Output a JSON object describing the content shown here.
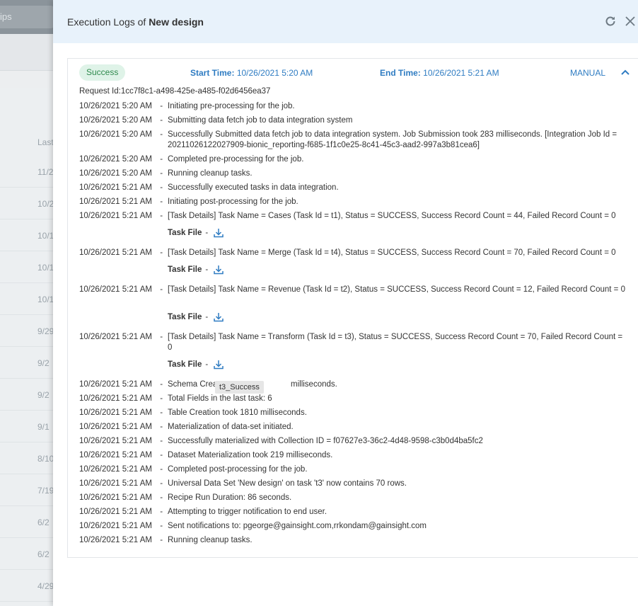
{
  "background": {
    "search_text": "ips",
    "column_header": "Last",
    "rows": [
      "11/2",
      "10/2",
      "10/1",
      "10/1",
      "10/1",
      "9/29",
      "9/2",
      "9/2",
      "9/1",
      "8/10",
      "7/19",
      "6/2",
      "6/2",
      "4/29"
    ]
  },
  "drawer": {
    "title_prefix": "Execution Logs of",
    "title_name": "New design",
    "refresh_icon": "refresh-icon",
    "close_icon": "close-icon"
  },
  "log": {
    "status": "Success",
    "start_time_label": "Start Time:",
    "start_time": "10/26/2021 5:20 AM",
    "end_time_label": "End Time:",
    "end_time": "10/26/2021 5:21 AM",
    "mode": "MANUAL",
    "request_id": "Request Id:1cc7f8c1-a498-425e-a485-f02d6456ea37",
    "task_file_label": "Task File",
    "task_file_dash": "-",
    "entries": [
      {
        "time": "10/26/2021 5:20 AM",
        "sep": " - ",
        "msg": "Initiating pre-processing for the job."
      },
      {
        "time": "10/26/2021 5:20 AM",
        "sep": " - ",
        "msg": "Submitting data fetch job to data integration system"
      },
      {
        "time": "10/26/2021 5:20 AM",
        "sep": " - ",
        "msg": "Successfully Submitted data fetch job to data integration system. Job Submission took 283 milliseconds. [Integration Job Id = 20211026122027909-bionic_reporting-f685-1f1c0e25-8c41-45c3-aad2-997a3b81cea6]"
      },
      {
        "time": "10/26/2021 5:20 AM",
        "sep": " - ",
        "msg": "Completed pre-processing for the job."
      },
      {
        "time": "10/26/2021 5:20 AM",
        "sep": " - ",
        "msg": "Running cleanup tasks."
      },
      {
        "time": "10/26/2021 5:21 AM",
        "sep": " - ",
        "msg": "Successfully executed tasks in data integration."
      },
      {
        "time": "10/26/2021 5:21 AM",
        "sep": " - ",
        "msg": "Initiating post-processing for the job."
      },
      {
        "time": "10/26/2021 5:21 AM",
        "sep": " - ",
        "msg": "[Task Details] Task Name = Cases (Task Id = t1), Status = SUCCESS, Success Record Count = 44, Failed Record Count = 0"
      },
      {
        "time": "10/26/2021 5:21 AM",
        "sep": " - ",
        "msg": "[Task Details] Task Name = Merge (Task Id = t4), Status = SUCCESS, Success Record Count = 70, Failed Record Count = 0"
      },
      {
        "time": "10/26/2021 5:21 AM",
        "sep": " - ",
        "msg": "[Task Details] Task Name = Revenue (Task Id = t2), Status = SUCCESS, Success Record Count = 12, Failed Record Count = 0"
      },
      {
        "time": "10/26/2021 5:21 AM",
        "sep": " - ",
        "msg": "[Task Details] Task Name = Transform (Task Id = t3), Status = SUCCESS, Success Record Count = 70, Failed Record Count = 0"
      },
      {
        "time": "10/26/2021 5:21 AM",
        "sep": " - ",
        "msg": "Schema Crea"
      },
      {
        "time": "10/26/2021 5:21 AM",
        "sep": " - ",
        "msg": "Total Fields in the last task: 6"
      },
      {
        "time": "10/26/2021 5:21 AM",
        "sep": " - ",
        "msg": "Table Creation took 1810 milliseconds."
      },
      {
        "time": "10/26/2021 5:21 AM",
        "sep": " - ",
        "msg": "Materialization of data-set initiated."
      },
      {
        "time": "10/26/2021 5:21 AM",
        "sep": " - ",
        "msg": "Successfully materialized with Collection ID = f07627e3-36c2-4d48-9598-c3b0d4ba5fc2"
      },
      {
        "time": "10/26/2021 5:21 AM",
        "sep": " - ",
        "msg": "Dataset Materialization took 219 milliseconds."
      },
      {
        "time": "10/26/2021 5:21 AM",
        "sep": " - ",
        "msg": "Completed post-processing for the job."
      },
      {
        "time": "10/26/2021 5:21 AM",
        "sep": " - ",
        "msg": "Universal Data Set 'New design' on task 't3' now contains 70 rows."
      },
      {
        "time": "10/26/2021 5:21 AM",
        "sep": " - ",
        "msg": "Recipe Run Duration: 86 seconds."
      },
      {
        "time": "10/26/2021 5:21 AM",
        "sep": " - ",
        "msg": "Attempting to trigger notification to end user."
      },
      {
        "time": "10/26/2021 5:21 AM",
        "sep": " - ",
        "msg": "Sent notifications to: pgeorge@gainsight.com,rrkondam@gainsight.com"
      },
      {
        "time": "10/26/2021 5:21 AM",
        "sep": " - ",
        "msg": "Running cleanup tasks."
      }
    ],
    "schema_tail": "milliseconds.",
    "tooltip": "t3_Success"
  },
  "colors": {
    "header_bg": "#e8f2fb",
    "accent": "#2f7cc2",
    "success_bg": "#dff3e8",
    "success_text": "#2f8a4d"
  }
}
